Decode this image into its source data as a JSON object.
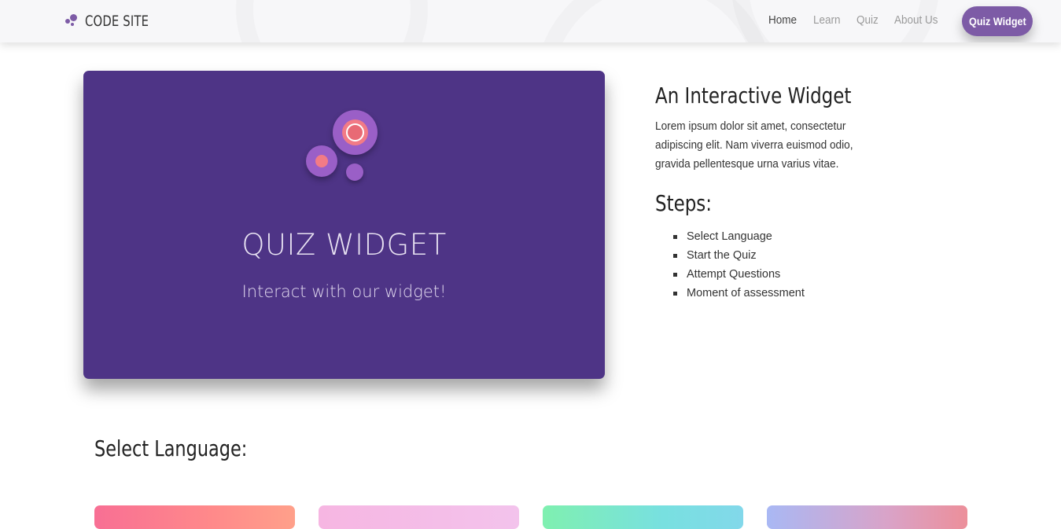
{
  "navbar": {
    "brand": "CODE SITE",
    "links": [
      {
        "label": "Home",
        "active": true
      },
      {
        "label": "Learn",
        "active": false
      },
      {
        "label": "Quiz",
        "active": false
      },
      {
        "label": "About Us",
        "active": false
      }
    ],
    "cta_label": "Quiz Widget"
  },
  "hero": {
    "title": "QUIZ WIDGET",
    "subtitle": "Interact with our widget!",
    "background": "#4e3486"
  },
  "info": {
    "heading": "An Interactive Widget",
    "text": "Lorem ipsum dolor sit amet, consectetur adipiscing elit. Nam viverra euismod odio, gravida pellentesque urna varius vitae.",
    "steps_heading": "Steps:",
    "steps": [
      "Select Language",
      "Start the Quiz",
      "Attempt Questions",
      "Moment of assessment"
    ]
  },
  "language": {
    "heading": "Select Language:",
    "cards": [
      {
        "gradient": "linear-gradient(90deg, #f86f94 0%, #ff8a8a 60%, #ffa08a 100%)"
      },
      {
        "gradient": "linear-gradient(90deg, #f6b6e2 0%, #f3c3ec 100%)"
      },
      {
        "gradient": "linear-gradient(90deg, #7ff0b0 0%, #78e0e0 60%, #82d8ea 100%)"
      },
      {
        "gradient": "linear-gradient(90deg, #a9b8f4 0%, #d9a3c8 60%, #ec8f9a 100%)"
      }
    ]
  },
  "colors": {
    "accent": "#7d5ba6",
    "hero_bg": "#4e3486"
  }
}
